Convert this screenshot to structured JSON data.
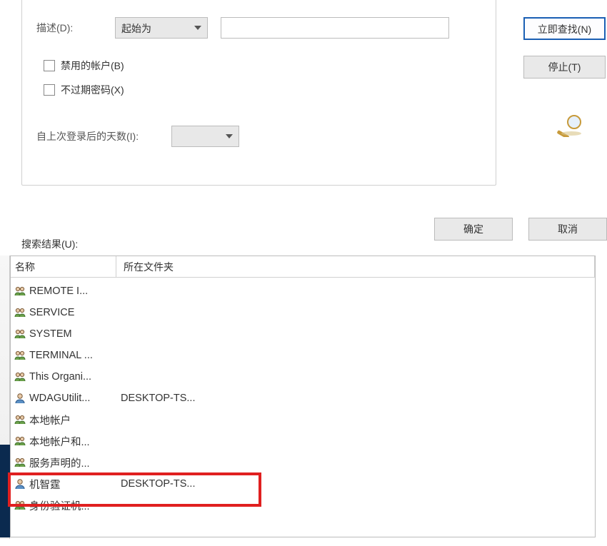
{
  "filter": {
    "desc_label": "描述(D):",
    "desc_combo": "起始为",
    "chk_disabled": "禁用的帐户(B)",
    "chk_noexpire": "不过期密码(X)",
    "days_label": "自上次登录后的天数(I):"
  },
  "buttons": {
    "find": "立即查找(N)",
    "stop": "停止(T)",
    "ok": "确定",
    "cancel": "取消"
  },
  "search_results_label": "搜索结果(U):",
  "columns": {
    "name": "名称",
    "folder": "所在文件夹"
  },
  "results": [
    {
      "icon": "group",
      "name": "REMOTE I...",
      "folder": ""
    },
    {
      "icon": "group",
      "name": "SERVICE",
      "folder": ""
    },
    {
      "icon": "group",
      "name": "SYSTEM",
      "folder": ""
    },
    {
      "icon": "group",
      "name": "TERMINAL ...",
      "folder": ""
    },
    {
      "icon": "group",
      "name": "This Organi...",
      "folder": ""
    },
    {
      "icon": "user",
      "name": "WDAGUtilit...",
      "folder": "DESKTOP-TS..."
    },
    {
      "icon": "group",
      "name": "本地帐户",
      "folder": ""
    },
    {
      "icon": "group",
      "name": "本地帐户和...",
      "folder": ""
    },
    {
      "icon": "group",
      "name": "服务声明的...",
      "folder": ""
    },
    {
      "icon": "user",
      "name": "机智霆",
      "folder": "DESKTOP-TS..."
    },
    {
      "icon": "group",
      "name": "身份验证机...",
      "folder": ""
    }
  ]
}
